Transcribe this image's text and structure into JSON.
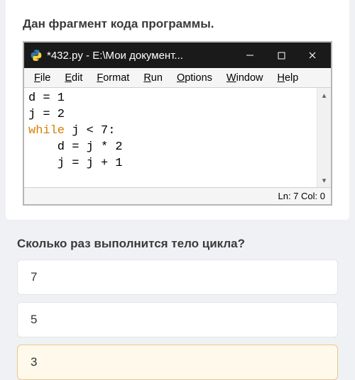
{
  "prompt": "Дан фрагмент кода программы.",
  "window": {
    "title": "*432.py - E:\\Мои документ..."
  },
  "menus": {
    "file": {
      "letter": "F",
      "rest": "ile"
    },
    "edit": {
      "letter": "E",
      "rest": "dit"
    },
    "format": {
      "letter": "F",
      "rest": "ormat"
    },
    "run": {
      "letter": "R",
      "rest": "un"
    },
    "options": {
      "letter": "O",
      "rest": "ptions"
    },
    "window": {
      "letter": "W",
      "rest": "indow"
    },
    "help": {
      "letter": "H",
      "rest": "elp"
    }
  },
  "code": {
    "l1": "d = 1",
    "l2": "j = 2",
    "l3a": "while",
    "l3b": " j < 7:",
    "l4": "    d = j * 2",
    "l5": "    j = j + 1"
  },
  "status": "Ln: 7  Col: 0",
  "question": "Сколько раз выполнится тело цикла?",
  "answers": {
    "a": "7",
    "b": "5",
    "c": "3"
  }
}
